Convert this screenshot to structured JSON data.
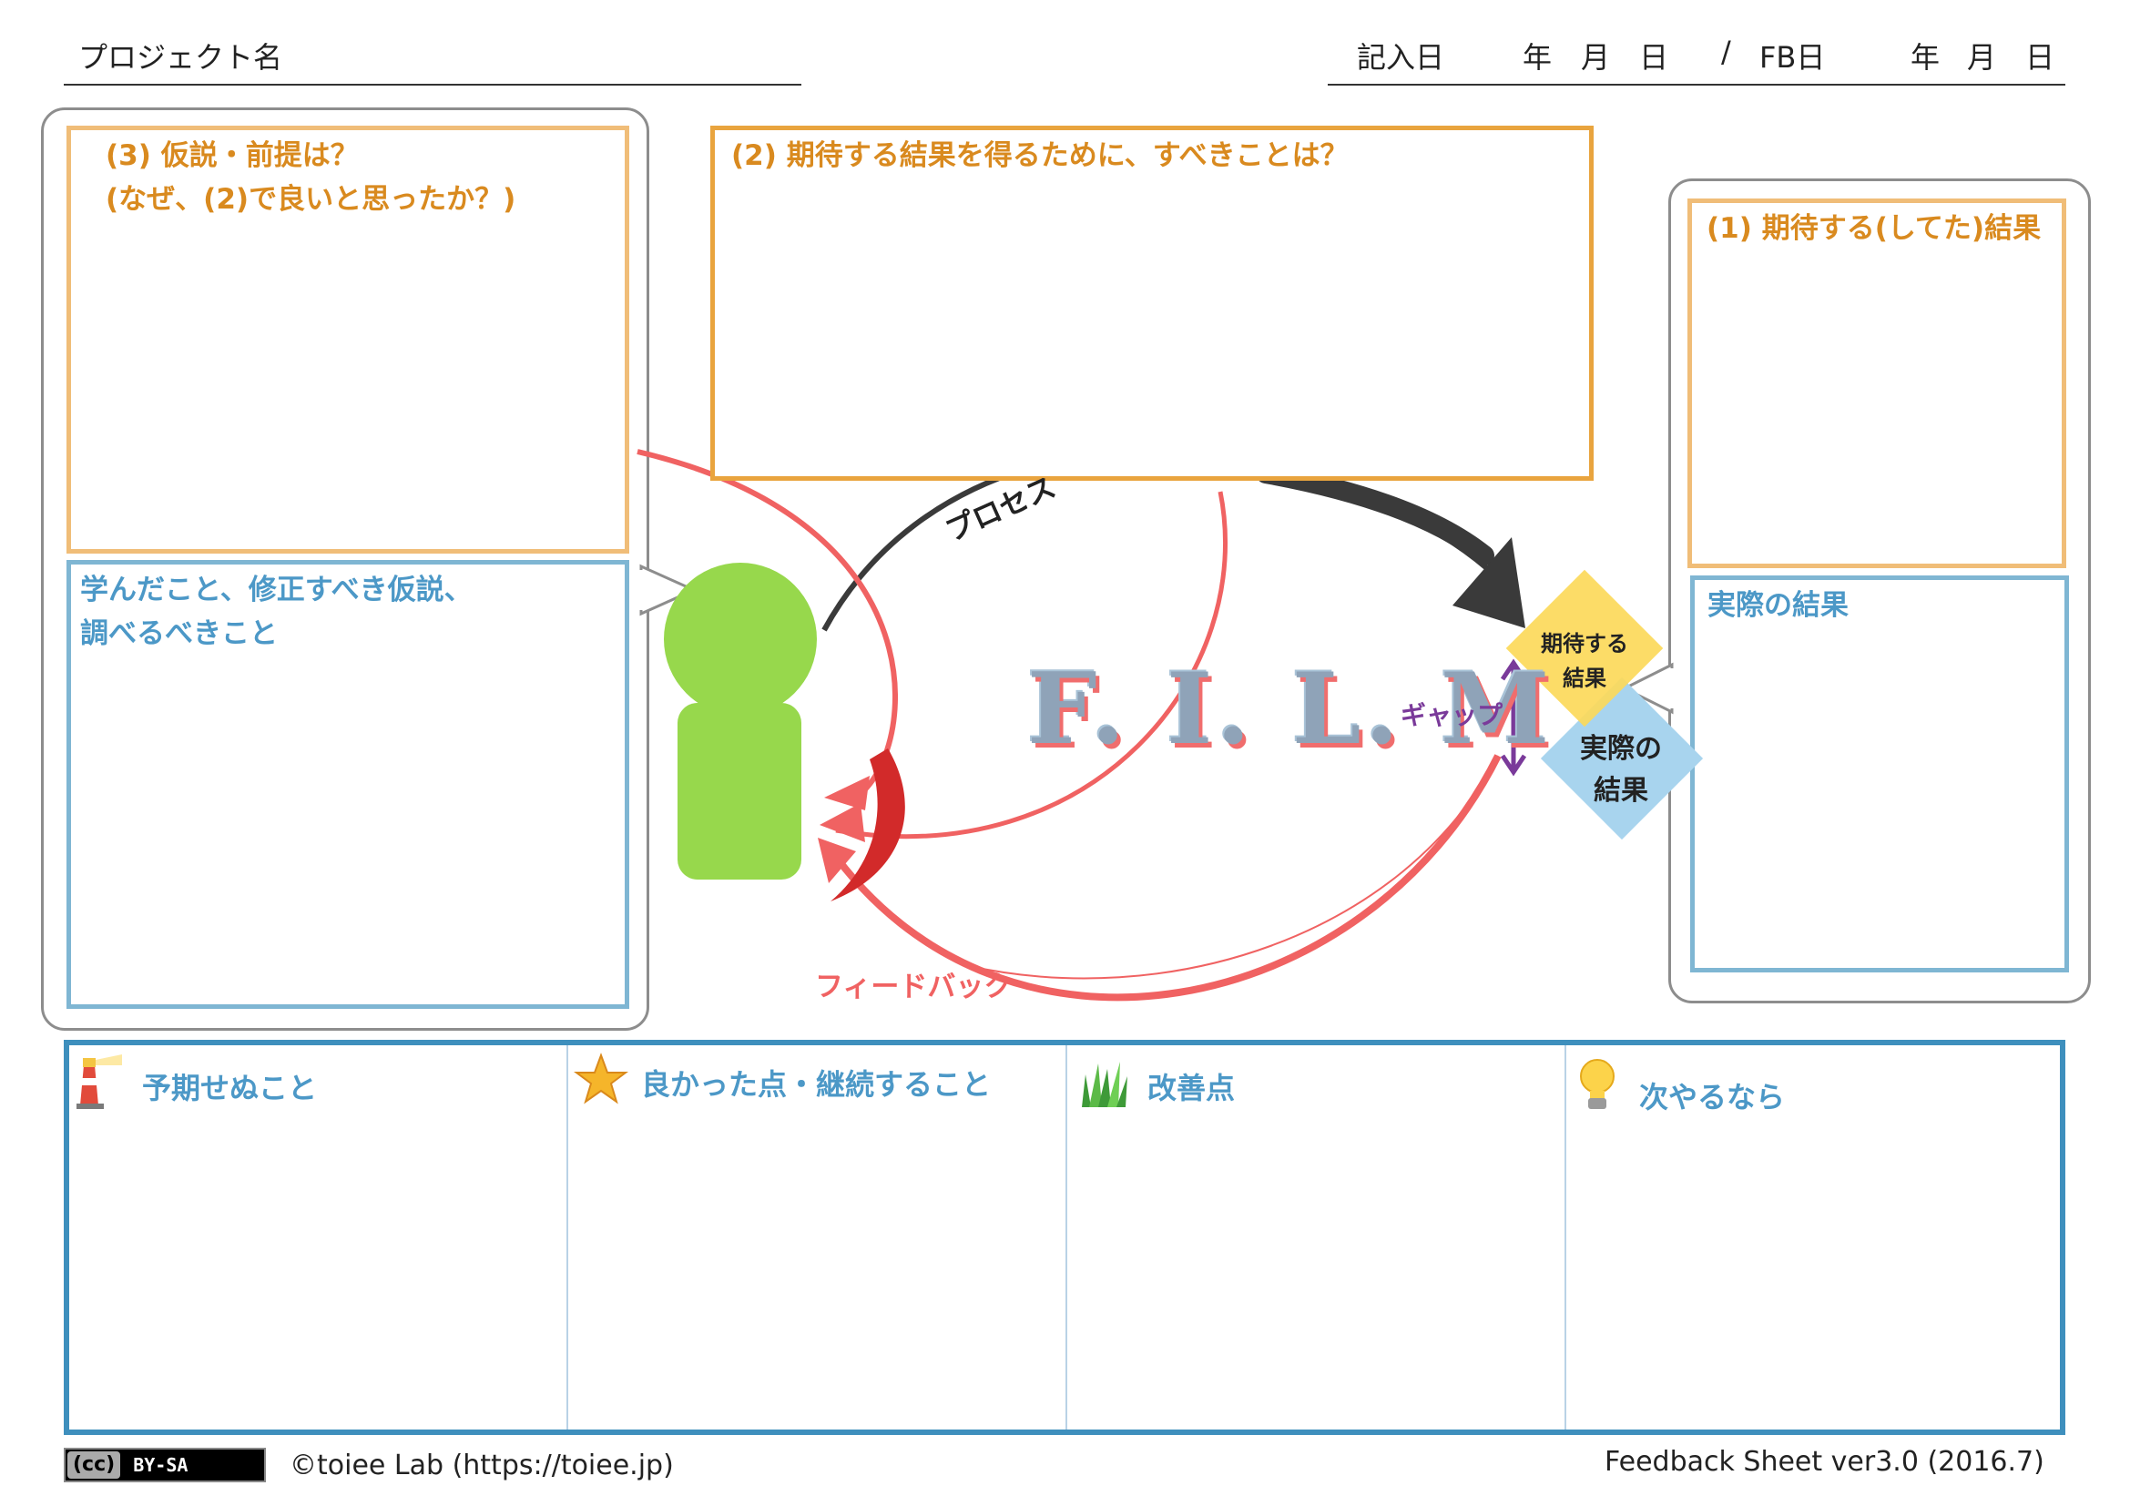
{
  "header": {
    "project_label": "プロジェクト名",
    "entry_date_label": "記入日",
    "year": "年",
    "month": "月",
    "day": "日",
    "separator": "/",
    "fb_date_label": "FB日"
  },
  "sections": {
    "hypothesis": {
      "line1": "(3) 仮説・前提は？",
      "line2": "(なぜ、(2)で良いと思ったか？)"
    },
    "learned": {
      "line1": "学んだこと、修正すべき仮説、",
      "line2": "調べるべきこと"
    },
    "todo": {
      "title": "(2) 期待する結果を得るために、すべきことは？"
    },
    "expected": {
      "title": "(1) 期待する(してた)結果"
    },
    "actual": {
      "title": "実際の結果"
    }
  },
  "diagram": {
    "process_label": "プロセス",
    "feedback_label": "フィードバック",
    "film_label": "F. I. L. M",
    "gap_label": "ギャップ",
    "expected_diamond": [
      "期待する",
      "結果"
    ],
    "actual_diamond": [
      "実際の",
      "結果"
    ],
    "colors": {
      "person": "#97d84c",
      "feedback_arrow": "#f06262",
      "process_arrow": "#3a3a3a",
      "expected_diamond": "#fcd95a",
      "actual_diamond": "#a8d4ee",
      "gap": "#7a3a9a"
    }
  },
  "bottom": {
    "columns": [
      {
        "icon": "lighthouse-icon",
        "label": "予期せぬこと"
      },
      {
        "icon": "star-icon",
        "label": "良かった点・継続すること"
      },
      {
        "icon": "grass-icon",
        "label": "改善点"
      },
      {
        "icon": "lightbulb-icon",
        "label": "次やるなら"
      }
    ]
  },
  "footer": {
    "license_cc": "(cc)",
    "license_type": "BY-SA",
    "copyright": "©toiee Lab (https://toiee.jp)",
    "version": "Feedback Sheet ver3.0 (2016.7)"
  }
}
